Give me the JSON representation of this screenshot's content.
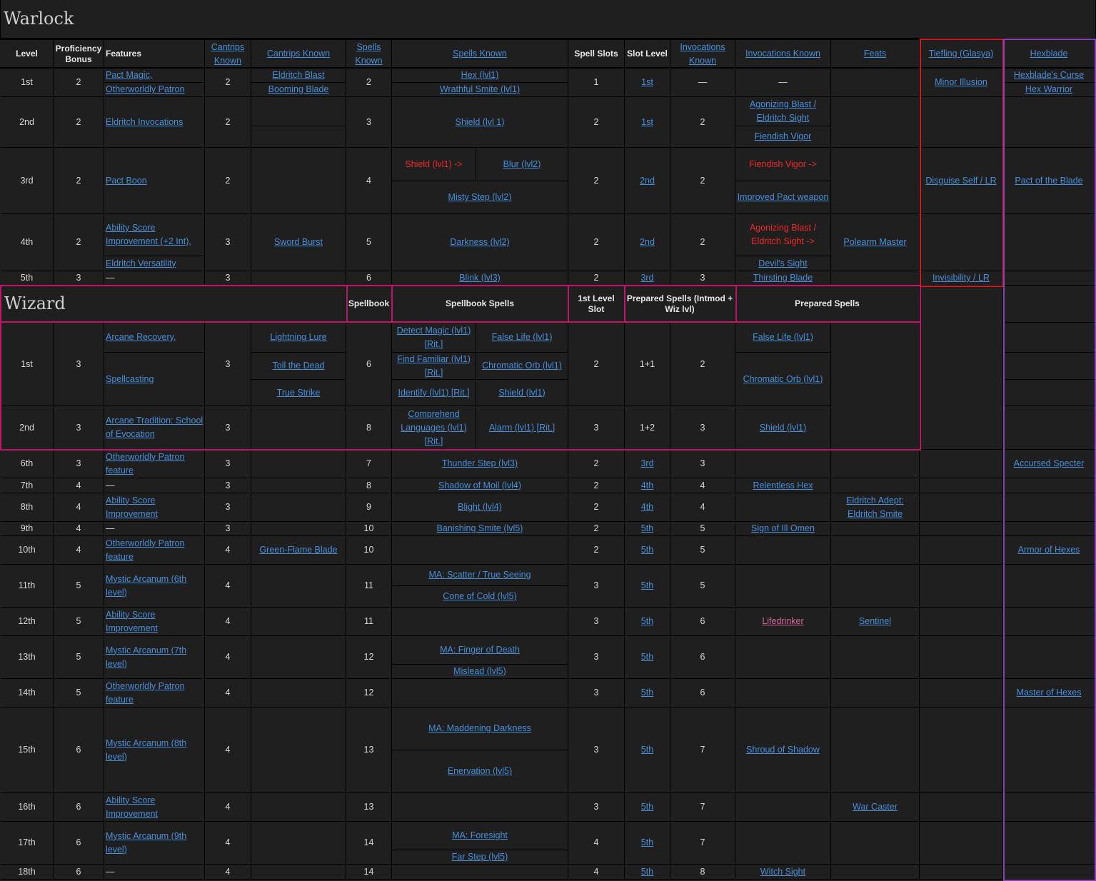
{
  "sections": {
    "warlock_title": "Warlock",
    "wizard_title": "Wizard"
  },
  "colors": {
    "background": "#1f1f1f",
    "link": "#4a8fd9",
    "warning": "#f02a2a",
    "tiefling_border": "#cc1e1e",
    "hexblade_border": "#8a3fc0",
    "wizard_border": "#c0166a"
  },
  "warlock_headers": [
    "Level",
    "Proficiency Bonus",
    "Features",
    "Cantrips Known",
    "Cantrips Known",
    "Spells Known",
    "Spells Known",
    "Spell Slots",
    "Slot Level",
    "Invocations Known",
    "Invocations Known",
    "Feats",
    "Tiefling (Glasya)",
    "Hexblade"
  ],
  "wizard_headers": [
    "Spellbook",
    "Spellbook Spells",
    "1st Level Slot",
    "Prepared Spells (Intmod + Wiz lvl)",
    "Prepared Spells"
  ],
  "cells": [
    {
      "t": "1st"
    },
    {
      "t": "2"
    },
    {
      "t": "Pact Magic,"
    },
    {
      "t": "Otherworldly Patron"
    },
    {
      "t": "2"
    },
    {
      "t": "Eldritch Blast"
    },
    {
      "t": "Booming Blade"
    },
    {
      "t": "2"
    },
    {
      "t": "Hex (lvl1)"
    },
    {
      "t": "Wrathful Smite (lvl1)"
    },
    {
      "t": "1"
    },
    {
      "t": "1st"
    },
    {
      "t": "—"
    },
    {
      "t": "—"
    },
    {
      "t": ""
    },
    {
      "t": "Minor Illusion"
    },
    {
      "t": "Hexblade's Curse"
    },
    {
      "t": "Hex Warrior"
    },
    {
      "t": "2nd"
    },
    {
      "t": "2"
    },
    {
      "t": "Eldritch Invocations"
    },
    {
      "t": "2"
    },
    {
      "t": "3"
    },
    {
      "t": "Shield (lvl 1)"
    },
    {
      "t": "2"
    },
    {
      "t": "1st"
    },
    {
      "t": "2"
    },
    {
      "t": "Agonizing Blast / Eldritch Sight"
    },
    {
      "t": "Fiendish Vigor"
    },
    {
      "t": "3rd"
    },
    {
      "t": "2"
    },
    {
      "t": "Pact Boon"
    },
    {
      "t": "2"
    },
    {
      "t": "4"
    },
    {
      "t": "Shield (lvl1) ->"
    },
    {
      "t": "Blur (lvl2)"
    },
    {
      "t": "Misty Step (lvl2)"
    },
    {
      "t": "2"
    },
    {
      "t": "2nd"
    },
    {
      "t": "2"
    },
    {
      "t": "Fiendish Vigor ->"
    },
    {
      "t": "Improved Pact weapon"
    },
    {
      "t": "Disguise Self / LR"
    },
    {
      "t": "Pact of the Blade"
    },
    {
      "t": "4th"
    },
    {
      "t": "2"
    },
    {
      "t": "Ability Score Improvement (+2 Int),"
    },
    {
      "t": "Eldritch Versatility"
    },
    {
      "t": "3"
    },
    {
      "t": "Sword Burst"
    },
    {
      "t": "5"
    },
    {
      "t": "Darkness (lvl2)"
    },
    {
      "t": "2"
    },
    {
      "t": "2nd"
    },
    {
      "t": "2"
    },
    {
      "t": "Agonizing Blast / Eldritch Sight ->"
    },
    {
      "t": "Devil's Sight"
    },
    {
      "t": "Polearm Master"
    },
    {
      "t": "5th"
    },
    {
      "t": "3"
    },
    {
      "t": "—"
    },
    {
      "t": "3"
    },
    {
      "t": "6"
    },
    {
      "t": "Blink (lvl3)"
    },
    {
      "t": "2"
    },
    {
      "t": "3rd"
    },
    {
      "t": "3"
    },
    {
      "t": "Thirsting Blade"
    },
    {
      "t": "Invisibility / LR"
    },
    {
      "t": "1st"
    },
    {
      "t": "3"
    },
    {
      "t": "Arcane Recovery,"
    },
    {
      "t": "Spellcasting"
    },
    {
      "t": "3"
    },
    {
      "t": "Lightning Lure"
    },
    {
      "t": "Toll the Dead"
    },
    {
      "t": "True Strike"
    },
    {
      "t": "6"
    },
    {
      "t": "Detect Magic (lvl1) [Rit.]"
    },
    {
      "t": "False Life (lvl1)"
    },
    {
      "t": "Find Familiar (lvl1) [Rit.]"
    },
    {
      "t": "Chromatic Orb (lvl1)"
    },
    {
      "t": "Identify (lvl1) [Rit.]"
    },
    {
      "t": "Shield (lvl1)"
    },
    {
      "t": "2"
    },
    {
      "t": "1+1"
    },
    {
      "t": "2"
    },
    {
      "t": "False Life (lvl1)"
    },
    {
      "t": "Chromatic Orb (lvl1)"
    },
    {
      "t": "2nd"
    },
    {
      "t": "3"
    },
    {
      "t": "Arcane Tradition: School of Evocation"
    },
    {
      "t": "3"
    },
    {
      "t": "8"
    },
    {
      "t": "Comprehend Languages (lvl1) [Rit.]"
    },
    {
      "t": "Alarm (lvl1) [Rit.]"
    },
    {
      "t": "3"
    },
    {
      "t": "1+2"
    },
    {
      "t": "3"
    },
    {
      "t": "Shield (lvl1)"
    },
    {
      "t": "6th"
    },
    {
      "t": "3"
    },
    {
      "t": "Otherworldly Patron feature"
    },
    {
      "t": "3"
    },
    {
      "t": "7"
    },
    {
      "t": "Thunder Step (lvl3)"
    },
    {
      "t": "2"
    },
    {
      "t": "3rd"
    },
    {
      "t": "3"
    },
    {
      "t": "Accursed Specter"
    },
    {
      "t": "7th"
    },
    {
      "t": "4"
    },
    {
      "t": "—"
    },
    {
      "t": "3"
    },
    {
      "t": "8"
    },
    {
      "t": "Shadow of Moil (lvl4)"
    },
    {
      "t": "2"
    },
    {
      "t": "4th"
    },
    {
      "t": "4"
    },
    {
      "t": "Relentless Hex"
    },
    {
      "t": "8th"
    },
    {
      "t": "4"
    },
    {
      "t": "Ability Score Improvement"
    },
    {
      "t": "3"
    },
    {
      "t": "9"
    },
    {
      "t": "Blight (lvl4)"
    },
    {
      "t": "2"
    },
    {
      "t": "4th"
    },
    {
      "t": "4"
    },
    {
      "t": "Eldritch Adept: Eldritch Smite"
    },
    {
      "t": "9th"
    },
    {
      "t": "4"
    },
    {
      "t": "—"
    },
    {
      "t": "3"
    },
    {
      "t": "10"
    },
    {
      "t": "Banishing Smite (lvl5)"
    },
    {
      "t": "2"
    },
    {
      "t": "5th"
    },
    {
      "t": "5"
    },
    {
      "t": "Sign of Ill Omen"
    },
    {
      "t": "10th"
    },
    {
      "t": "4"
    },
    {
      "t": "Otherworldly Patron feature"
    },
    {
      "t": "4"
    },
    {
      "t": "Green-Flame Blade"
    },
    {
      "t": "10"
    },
    {
      "t": "2"
    },
    {
      "t": "5th"
    },
    {
      "t": "5"
    },
    {
      "t": "Armor of Hexes"
    },
    {
      "t": "11th"
    },
    {
      "t": "5"
    },
    {
      "t": "Mystic Arcanum (6th level)"
    },
    {
      "t": "4"
    },
    {
      "t": "11"
    },
    {
      "t": "MA: Scatter / True Seeing"
    },
    {
      "t": "Cone of Cold (lvl5)"
    },
    {
      "t": "3"
    },
    {
      "t": "5th"
    },
    {
      "t": "5"
    },
    {
      "t": "12th"
    },
    {
      "t": "5"
    },
    {
      "t": "Ability Score Improvement"
    },
    {
      "t": "4"
    },
    {
      "t": "11"
    },
    {
      "t": "3"
    },
    {
      "t": "5th"
    },
    {
      "t": "6"
    },
    {
      "t": "Lifedrinker"
    },
    {
      "t": "Sentinel"
    },
    {
      "t": "13th"
    },
    {
      "t": "5"
    },
    {
      "t": "Mystic Arcanum (7th level)"
    },
    {
      "t": "4"
    },
    {
      "t": "12"
    },
    {
      "t": "MA: Finger of Death"
    },
    {
      "t": "Mislead (lvl5)"
    },
    {
      "t": "3"
    },
    {
      "t": "5th"
    },
    {
      "t": "6"
    },
    {
      "t": "14th"
    },
    {
      "t": "5"
    },
    {
      "t": "Otherworldly Patron feature"
    },
    {
      "t": "4"
    },
    {
      "t": "12"
    },
    {
      "t": "3"
    },
    {
      "t": "5th"
    },
    {
      "t": "6"
    },
    {
      "t": "Master of Hexes"
    },
    {
      "t": "15th"
    },
    {
      "t": "6"
    },
    {
      "t": "Mystic Arcanum (8th level)"
    },
    {
      "t": "4"
    },
    {
      "t": "13"
    },
    {
      "t": "MA: Maddening Darkness"
    },
    {
      "t": "Enervation (lvl5)"
    },
    {
      "t": "3"
    },
    {
      "t": "5th"
    },
    {
      "t": "7"
    },
    {
      "t": "Shroud of Shadow"
    },
    {
      "t": "16th"
    },
    {
      "t": "6"
    },
    {
      "t": "Ability Score Improvement"
    },
    {
      "t": "4"
    },
    {
      "t": "13"
    },
    {
      "t": "3"
    },
    {
      "t": "5th"
    },
    {
      "t": "7"
    },
    {
      "t": "War Caster"
    },
    {
      "t": "17th"
    },
    {
      "t": "6"
    },
    {
      "t": "Mystic Arcanum (9th level)"
    },
    {
      "t": "4"
    },
    {
      "t": "14"
    },
    {
      "t": "MA: Foresight"
    },
    {
      "t": "Far Step (lvl5)"
    },
    {
      "t": "4"
    },
    {
      "t": "5th"
    },
    {
      "t": "7"
    },
    {
      "t": "18th"
    },
    {
      "t": "6"
    },
    {
      "t": "—"
    },
    {
      "t": "4"
    },
    {
      "t": "14"
    },
    {
      "t": "4"
    },
    {
      "t": "5th"
    },
    {
      "t": "8"
    },
    {
      "t": "Witch Sight"
    }
  ]
}
